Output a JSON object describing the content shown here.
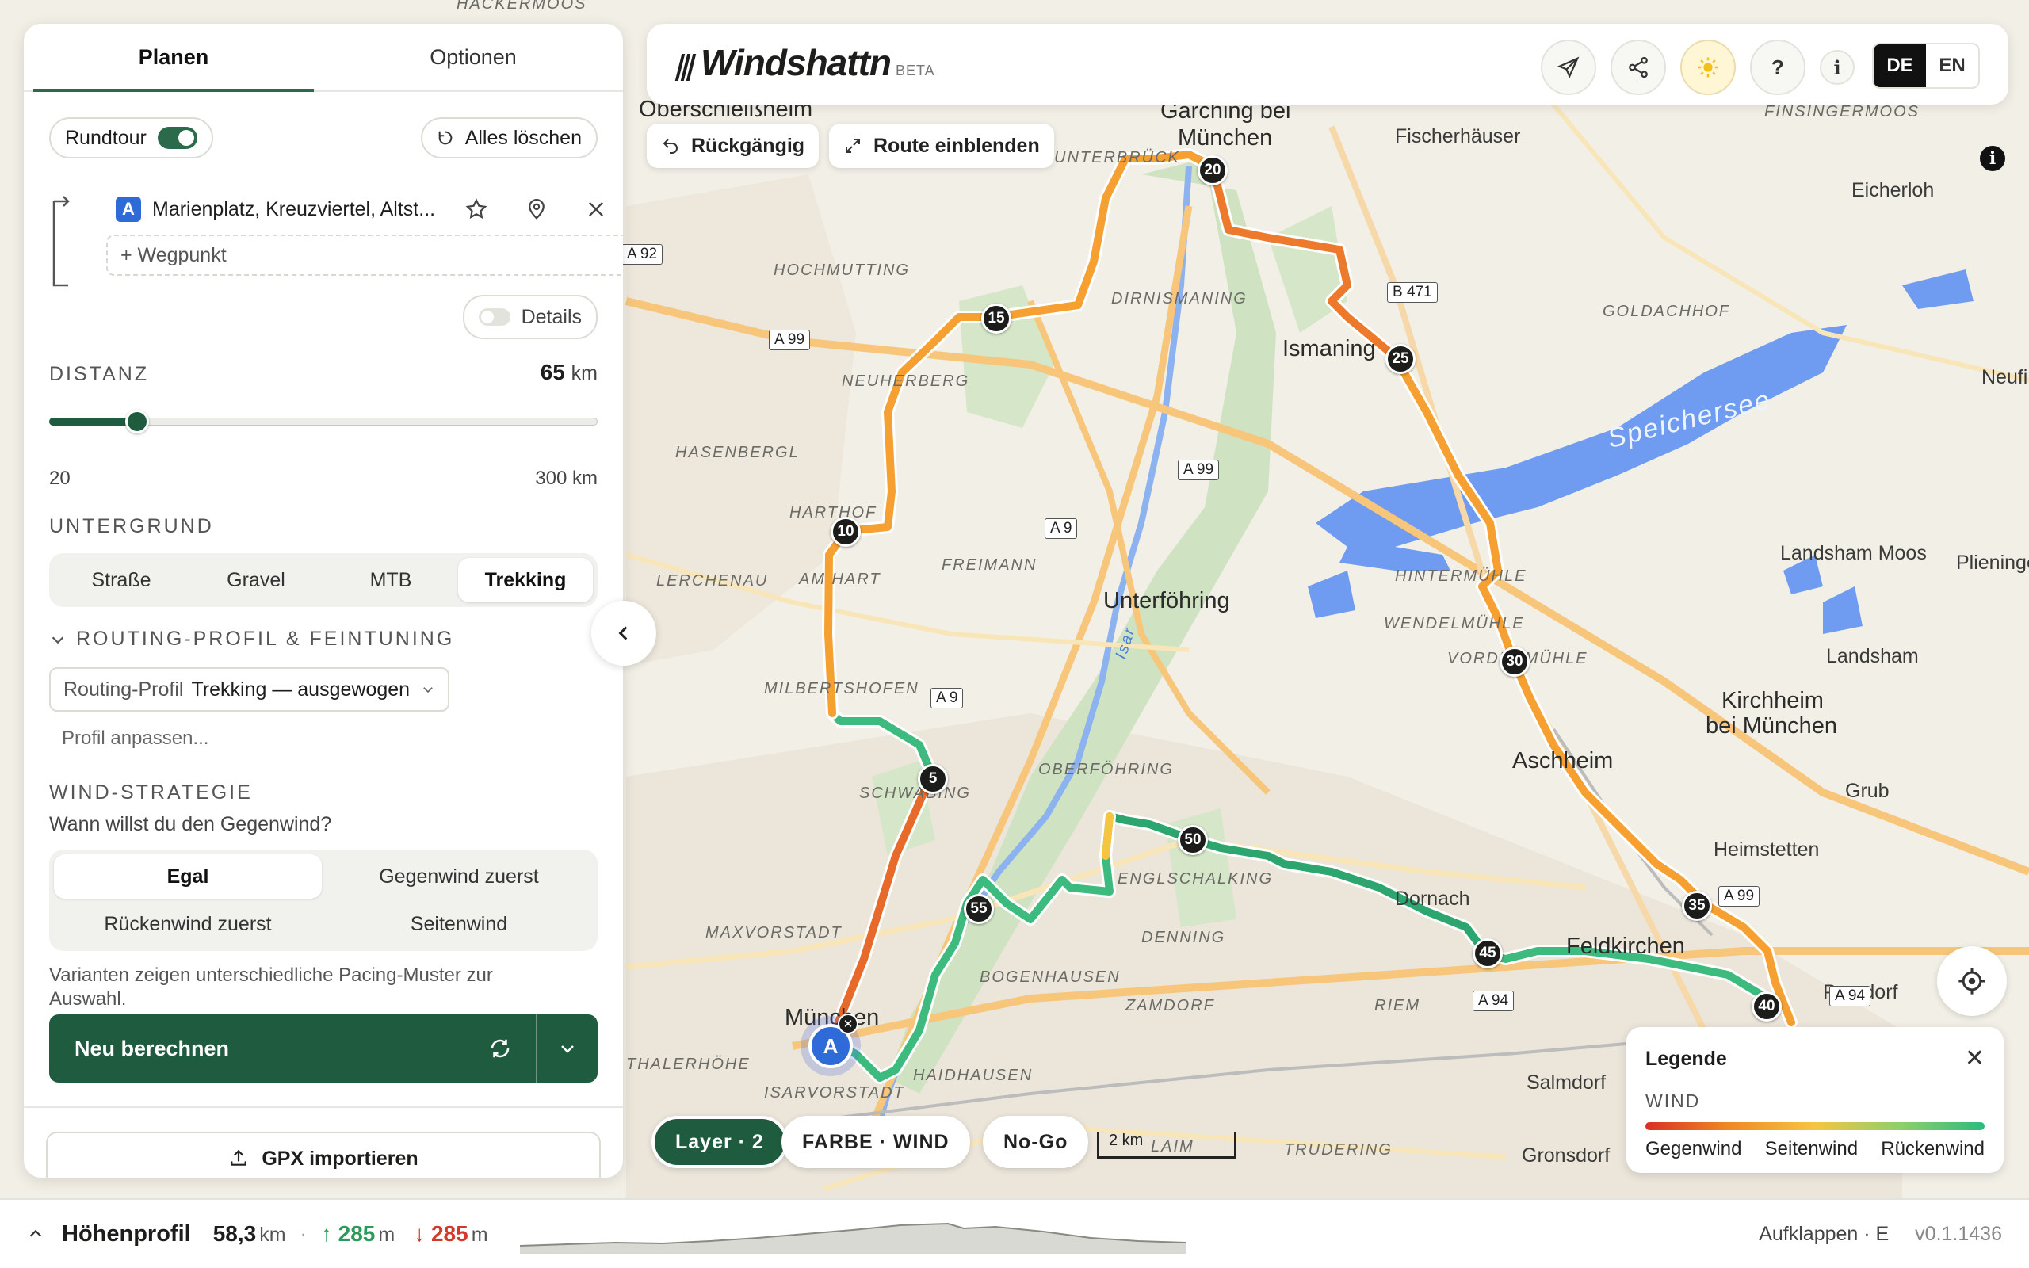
{
  "app": {
    "name": "Windshattn",
    "beta": "BETA"
  },
  "tabs": [
    {
      "label": "Planen"
    },
    {
      "label": "Optionen"
    }
  ],
  "route_options": {
    "roundtrip_label": "Rundtour",
    "roundtrip_on": true,
    "clear_all_label": "Alles löschen",
    "start_badge": "A",
    "start_address": "Marienplatz, Kreuzviertel, Altst...",
    "add_waypoint_placeholder": "+ Wegpunkt",
    "details_label": "Details",
    "details_on": false
  },
  "distance": {
    "label": "DISTANZ",
    "value": "65",
    "unit": "km",
    "min": "20",
    "max": "300 km",
    "fraction": 0.16
  },
  "surface": {
    "label": "UNTERGRUND",
    "options": [
      "Straße",
      "Gravel",
      "MTB",
      "Trekking"
    ],
    "selected": "Trekking"
  },
  "routing_profile": {
    "section_label": "ROUTING-PROFIL & FEINTUNING",
    "select_prefix": "Routing-Profil",
    "select_value": "Trekking — ausgewogen",
    "customize_link": "Profil anpassen..."
  },
  "wind_strategy": {
    "label": "WIND-STRATEGIE",
    "question": "Wann willst du den Gegenwind?",
    "options": [
      "Egal",
      "Gegenwind zuerst",
      "Rückenwind zuerst",
      "Seitenwind"
    ],
    "selected": "Egal",
    "hint": "Varianten zeigen unterschiedliche Pacing-Muster zur Auswahl."
  },
  "recalculate_label": "Neu berechnen",
  "gpx_import_label": "GPX importieren",
  "topbar": {
    "languages": [
      "DE",
      "EN"
    ],
    "selected_language": "DE",
    "help_label": "?",
    "info_label": "i",
    "undo_label": "Rückgängig",
    "show_route_label": "Route einblenden"
  },
  "map": {
    "places": [
      "Oberschleißheim",
      "Garching bei",
      "München",
      "Fischerhäuser",
      "Eicherloh",
      "Ismaning",
      "Speichersee",
      "Landsham Moos",
      "Plieninge",
      "Landsham",
      "Kirchheim",
      "bei München",
      "Unterföhring",
      "Aschheim",
      "Grub",
      "Heimstetten",
      "Dornach",
      "Feldkirchen",
      "Salmdorf",
      "Gronsdorf",
      "Parsdorf",
      "Neufin",
      "München"
    ],
    "district_labels": [
      "HOCHMUTTING",
      "DIRNISMANING",
      "NEUHERBERG",
      "HASENBERGL",
      "HARTHOF",
      "FREIMANN",
      "LERCHENAU",
      "AM HART",
      "MILBERTSHOFEN",
      "SCHWABING",
      "OBERFÖHRING",
      "ENGLSCHALKING",
      "DENNING",
      "BOGENHAUSEN",
      "ZAMDORF",
      "MAXVORSTADT",
      "HAIDHAUSEN",
      "ISARVORSTADT",
      "THALERHÖHE",
      "RIEM",
      "TRUDERING",
      "HINTERMÜHLE",
      "WENDELMÜHLE",
      "VORDERMÜHLE",
      "GOLDACHHOF",
      "FINSINGERMOOS",
      "HACKERMOOS",
      "UNTERBRÜCK",
      "LAIM"
    ],
    "road_shields": [
      "A 92",
      "A 99",
      "A 9",
      "A 99",
      "B 471",
      "A 9",
      "A 99",
      "A 94",
      "A 94"
    ],
    "km_markers": [
      "5",
      "10",
      "15",
      "20",
      "25",
      "30",
      "35",
      "40",
      "45",
      "50",
      "55"
    ],
    "river_label": "Isar",
    "start_marker": "A"
  },
  "map_controls": {
    "layer_label": "Layer · 2",
    "color_label": "FARBE · WIND",
    "nogo_label": "No-Go",
    "scale_label": "2 km"
  },
  "legend": {
    "title": "Legende",
    "subtitle": "WIND",
    "labels": [
      "Gegenwind",
      "Seitenwind",
      "Rückenwind"
    ],
    "colors": [
      "#d93025",
      "#f08a24",
      "#f5c542",
      "#8fcf6a",
      "#2dbb7e"
    ]
  },
  "bottombar": {
    "title": "Höhenprofil",
    "distance": "58,3",
    "distance_unit": "km",
    "ascent": "285",
    "descent": "285",
    "elev_unit": "m",
    "expand_label": "Aufklappen · E",
    "version": "v0.1.1436"
  },
  "colors": {
    "accent": "#1f5c3f",
    "headwind": "#e0522a",
    "crosswind": "#f5a030",
    "tailwind": "#2dbb7e",
    "start": "#2f6bd8"
  }
}
